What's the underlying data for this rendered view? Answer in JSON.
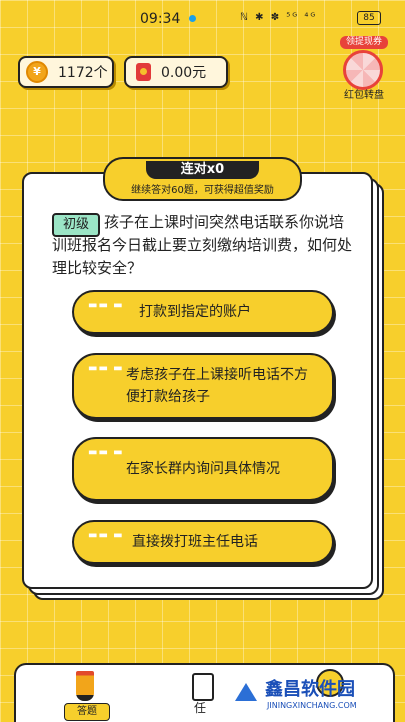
{
  "status_bar": {
    "time": "09:34",
    "icons": "ℕ ✱ ✽ ⁵ᴳ ⁴ᴳ",
    "battery": "85"
  },
  "wallet": {
    "coins": "1172个",
    "cash": "0.00元"
  },
  "wheel": {
    "tag": "领提现券",
    "label": "红包转盘"
  },
  "streak": {
    "title": "连对x0",
    "subtitle": "继续答对60题，可获得超值奖励"
  },
  "question": {
    "level": "初级",
    "text": "孩子在上课时间突然电话联系你说培训班报名今日截止要立刻缴纳培训费，如何处理比较安全？"
  },
  "options": [
    {
      "text": "打款到指定的账户"
    },
    {
      "text": "考虑孩子在上课接听电话不方便打款给孩子"
    },
    {
      "text": "在家长群内询问具体情况"
    },
    {
      "text": "直接拨打班主任电话"
    }
  ],
  "tabbar": {
    "answer": "答题",
    "task": "任"
  },
  "watermark": {
    "name": "鑫昌软件园",
    "url": "JININGXINCHANG.COM"
  },
  "colors": {
    "background": "#f7cf2c",
    "accent_green": "#9be5c6",
    "red": "#e23a3a"
  },
  "icons": {
    "coin": "coin-icon",
    "envelope": "red-envelope-icon",
    "wheel": "prize-wheel-icon",
    "pencil": "pencil-icon",
    "task": "clipboard-icon"
  }
}
